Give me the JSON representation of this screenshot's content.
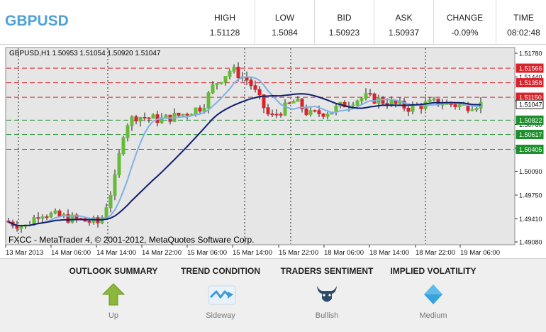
{
  "header": {
    "symbol": "GBPUSD",
    "columns": [
      {
        "title": "HIGH",
        "value": "1.51128"
      },
      {
        "title": "LOW",
        "value": "1.5084"
      },
      {
        "title": "BID",
        "value": "1.50923"
      },
      {
        "title": "ASK",
        "value": "1.50937"
      },
      {
        "title": "CHANGE",
        "value": "-0.09%"
      },
      {
        "title": "TIME",
        "value": "08:02:48"
      }
    ]
  },
  "chart": {
    "info_label": "GBPUSD,H1  1.50953 1.51054 1.50920 1.51047",
    "copyright": "FXCC - MetaTrader 4, © 2001-2012, MetaQuotes Software Corp.",
    "y_ticks": [
      "1.51780",
      "1.51440",
      "1.51100",
      "1.50760",
      "1.50420",
      "1.50090",
      "1.49750",
      "1.49410",
      "1.49080"
    ],
    "price_tags": [
      {
        "label": "1.51566",
        "kind": "red"
      },
      {
        "label": "1.51358",
        "kind": "red"
      },
      {
        "label": "1.51150",
        "kind": "red"
      },
      {
        "label": "1.51047",
        "kind": "current"
      },
      {
        "label": "1.50822",
        "kind": "green"
      },
      {
        "label": "1.50617",
        "kind": "green"
      },
      {
        "label": "1.50405",
        "kind": "green"
      }
    ],
    "x_ticks": [
      "13 Mar 2013",
      "14 Mar 06:00",
      "14 Mar 14:00",
      "14 Mar 22:00",
      "15 Mar 06:00",
      "15 Mar 14:00",
      "15 Mar 22:00",
      "18 Mar 06:00",
      "18 Mar 14:00",
      "18 Mar 22:00",
      "19 Mar 06:00"
    ],
    "colors": {
      "background": "#e6e6e6",
      "bull": "#66bb3a",
      "bear": "#d9232a",
      "ma_fast": "#7fb0e6",
      "ma_slow": "#0f1e6e",
      "resistance": "#d9232a",
      "support": "#1a8f2a"
    }
  },
  "chart_data": {
    "type": "candlestick",
    "title": "GBPUSD,H1",
    "ylim": [
      1.4908,
      1.5178
    ],
    "resistance_levels": [
      1.51566,
      1.51358,
      1.5115
    ],
    "support_levels": [
      1.50822,
      1.50617,
      1.50405
    ],
    "current_price": 1.51047
  },
  "panel": {
    "items": [
      {
        "title": "OUTLOOK SUMMARY",
        "value": "Up",
        "icon": "up-arrow-icon"
      },
      {
        "title": "TREND CONDITION",
        "value": "Sideway",
        "icon": "sideway-trend-icon"
      },
      {
        "title": "TRADERS SENTIMENT",
        "value": "Bullish",
        "icon": "bull-icon"
      },
      {
        "title": "IMPLIED VOLATILITY",
        "value": "Medium",
        "icon": "diamond-icon"
      }
    ]
  }
}
